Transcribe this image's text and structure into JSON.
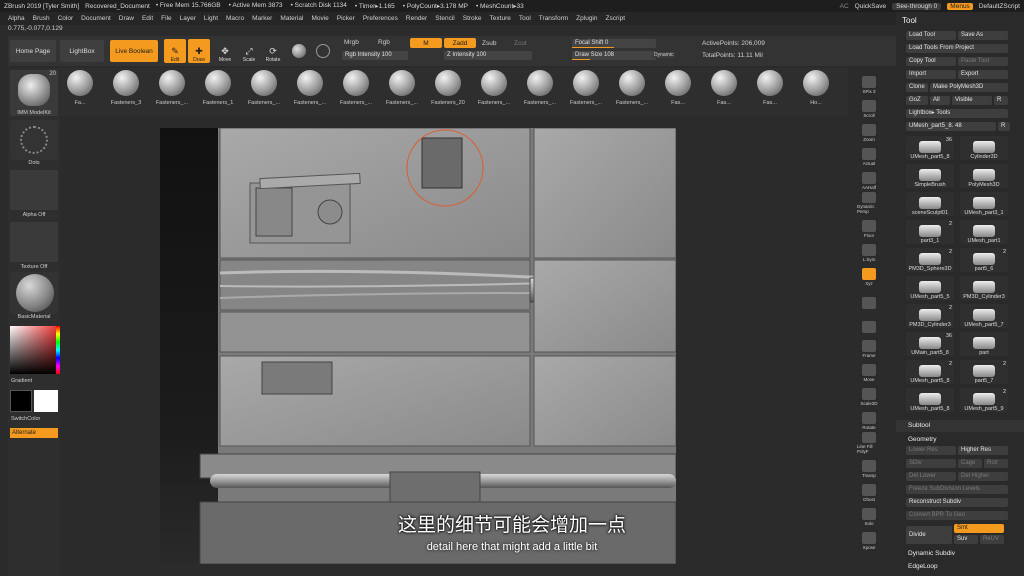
{
  "titlebar": {
    "app_title": "ZBrush 2019 [Tyler Smith]",
    "document": "Recovered_Document",
    "free_mem": "• Free Mem 15.766GB",
    "active_mem": "• Active Mem 3873",
    "scratch": "• Scratch Disk 1134",
    "timer": "• Timer▸1.165",
    "polycount": "• PolyCount▸3.178 MP",
    "meshcount": "• MeshCount▸33",
    "ac": "AC",
    "quicksave": "QuickSave",
    "seethrough": "See-through  0",
    "menus": "Menus",
    "defaultzscript": "DefaultZScript"
  },
  "menubar": [
    "Alpha",
    "Brush",
    "Color",
    "Document",
    "Draw",
    "Edit",
    "File",
    "Layer",
    "Light",
    "Macro",
    "Marker",
    "Material",
    "Movie",
    "Picker",
    "Preferences",
    "Render",
    "Stencil",
    "Stroke",
    "Texture",
    "Tool",
    "Transform",
    "Zplugin",
    "Zscript"
  ],
  "coords": "0.775,-0.077,0.129",
  "topshelf": {
    "home_page": "Home Page",
    "lightbox": "LightBox",
    "live_boolean": "Live Boolean",
    "edit": "Edit",
    "draw": "Draw",
    "move": "Move",
    "scale": "Scale",
    "rotate": "Rotate",
    "mrgb": "Mrgb",
    "rgb": "Rgb",
    "rgb_intensity": "Rgb Intensity 100",
    "m": "M",
    "zadd": "Zadd",
    "zsub": "Zsub",
    "zcut": "Zcut",
    "z_intensity": "Z Intensity 100",
    "focal_shift": "Focal Shift 0",
    "draw_size": "Draw Size 108",
    "dynamic": "Dynamic",
    "active_points": "ActivePoints: 206,009",
    "total_points": "TotalPoints: 11.11 Mil"
  },
  "brushes": [
    {
      "label": "Fa..."
    },
    {
      "label": "Fasteners_3"
    },
    {
      "label": "Fasteners_..."
    },
    {
      "label": "Fasteners_1"
    },
    {
      "label": "Fasteners_..."
    },
    {
      "label": "Fasteners_..."
    },
    {
      "label": "Fasteners_..."
    },
    {
      "label": "Fasteners_..."
    },
    {
      "label": "Fasteners_20"
    },
    {
      "label": "Fasteners_..."
    },
    {
      "label": "Fasteners_..."
    },
    {
      "label": "Fasteners_..."
    },
    {
      "label": "Fasteners_..."
    },
    {
      "label": "Fas..."
    },
    {
      "label": "Fas..."
    },
    {
      "label": "Fas..."
    },
    {
      "label": "Ho..."
    }
  ],
  "leftpanel": {
    "brush_name": "IMM ModelKit",
    "dots": "Dots",
    "alpha": "Alpha Off",
    "texture": "Texture Off",
    "material": "BasicMaterial",
    "gradient": "Gradient",
    "switchcolor": "SwitchColor",
    "alternate": "Alternate",
    "brush_count": "20"
  },
  "rightcol": [
    "SPix 3",
    "Scroll",
    "Zoom",
    "Actual",
    "AAHalf",
    "Dynamic Persp",
    "Floor",
    "L.Sym",
    "Xyz",
    "",
    "",
    "Frame",
    "Move",
    "Scale3D",
    "Rotate",
    "Line Fill PolyF",
    "Transp",
    "Ghost",
    "Solo",
    "Xpose"
  ],
  "toolpanel": {
    "header": "Tool",
    "load_tool": "Load Tool",
    "save_as": "Save As",
    "load_from_project": "Load Tools From Project",
    "copy_tool": "Copy Tool",
    "paste_tool": "Paste Tool",
    "import": "Import",
    "export": "Export",
    "clone": "Clone",
    "make_polymesh": "Make PolyMesh3D",
    "goz": "GoZ",
    "all": "All",
    "visible": "Visible",
    "r": "R",
    "lightbox_tools": "Lightbox▸ Tools",
    "current_tool": "UMesh_part5_8. 48",
    "subtool": "Subtool",
    "geometry": "Geometry",
    "lower_res": "Lower Res",
    "higher_res": "Higher Res",
    "sdiv": "SDiv",
    "cage": "Cage",
    "rstr": "Rstr",
    "del_lower": "Del Lower",
    "del_higher": "Del Higher",
    "freeze": "Freeze SubDivision Levels",
    "reconstruct": "Reconstruct Subdiv",
    "convert_bpr": "Convert BPR To Geo",
    "divide": "Divide",
    "smt": "Smt",
    "suv": "Suv",
    "reuv": "ReUV",
    "dynamic_subdiv": "Dynamic Subdiv",
    "edgeloop": "EdgeLoop",
    "thumbs": [
      {
        "label": "UMesh_part5_8",
        "count": "36"
      },
      {
        "label": "Cylinder3D",
        "count": ""
      },
      {
        "label": "SimpleBrush",
        "count": ""
      },
      {
        "label": "PolyMesh3D",
        "count": ""
      },
      {
        "label": "sceneSculpt01",
        "count": ""
      },
      {
        "label": "UMesh_part3_1",
        "count": ""
      },
      {
        "label": "part3_1",
        "count": "2"
      },
      {
        "label": "UMesh_part1",
        "count": ""
      },
      {
        "label": "PM3D_Sphere3D",
        "count": "2"
      },
      {
        "label": "part5_6",
        "count": "2"
      },
      {
        "label": "UMesh_part5_5",
        "count": ""
      },
      {
        "label": "PM3D_Cylinder3",
        "count": ""
      },
      {
        "label": "PM3D_Cylinder3",
        "count": "2"
      },
      {
        "label": "UMesh_part5_7",
        "count": ""
      },
      {
        "label": "UMain_part5_8",
        "count": "36"
      },
      {
        "label": "part",
        "count": ""
      },
      {
        "label": "UMesh_part5_8",
        "count": "2"
      },
      {
        "label": "part5_7",
        "count": "2"
      },
      {
        "label": "UMesh_part5_8",
        "count": ""
      },
      {
        "label": "UMesh_part5_9",
        "count": "2"
      }
    ]
  },
  "subtitle": {
    "cn": "这里的细节可能会增加一点",
    "en": "detail here that might add a little bit"
  },
  "colors": {
    "accent": "#f39a1f",
    "bg": "#2b2b2b"
  }
}
